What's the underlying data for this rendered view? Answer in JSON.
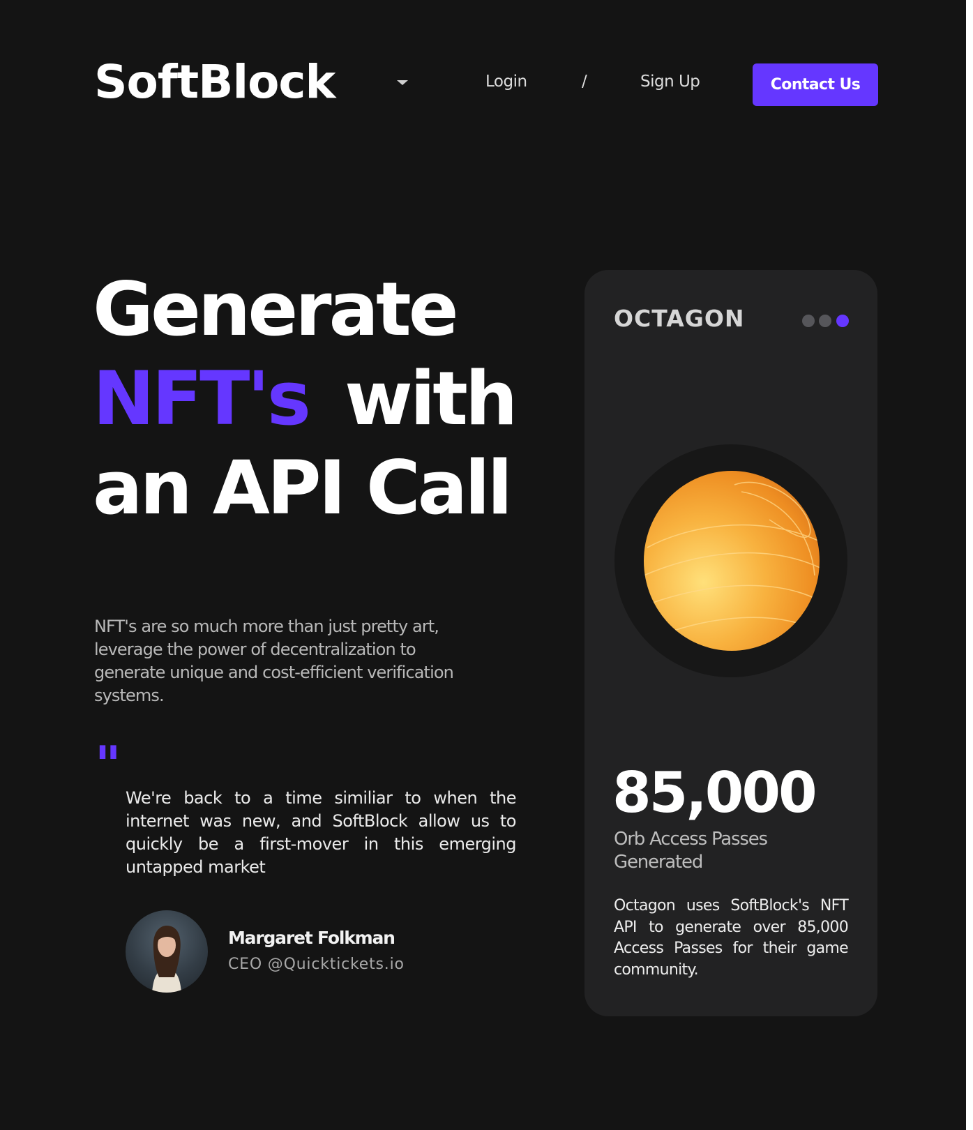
{
  "header": {
    "logo": "SoftBlock",
    "nav": {
      "login": "Login",
      "separator": "/",
      "signup": "Sign Up"
    },
    "contact_label": "Contact Us"
  },
  "hero": {
    "line1": "Generate",
    "line2_accent": "NFT's",
    "line2_rest": "with",
    "line3": "an API Call",
    "description": "NFT's are so much more than just pretty art, leverage the power of decentralization to generate unique and cost-efficient verification systems."
  },
  "testimonial": {
    "quote_mark": "\"",
    "quote": "We're back to a time similiar to when the internet was new, and SoftBlock allow us to quickly be a first-mover in this emerging untapped market",
    "author_name": "Margaret Folkman",
    "author_title": "CEO @Quicktickets.io"
  },
  "card": {
    "title": "OCTAGON",
    "stat_number": "85,000",
    "stat_label": "Orb Access Passes Generated",
    "description": "Octagon uses SoftBlock's NFT API to generate over 85,000 Access Passes for their game community.",
    "active_dot": 3
  },
  "colors": {
    "background": "#141414",
    "accent": "#6537ff",
    "card": "#222223",
    "orb": "#f4a52c"
  },
  "icons": {
    "nav_caret": "caret-down-icon",
    "carousel": "pagination-dots-icon",
    "quote": "quote-mark-icon"
  }
}
